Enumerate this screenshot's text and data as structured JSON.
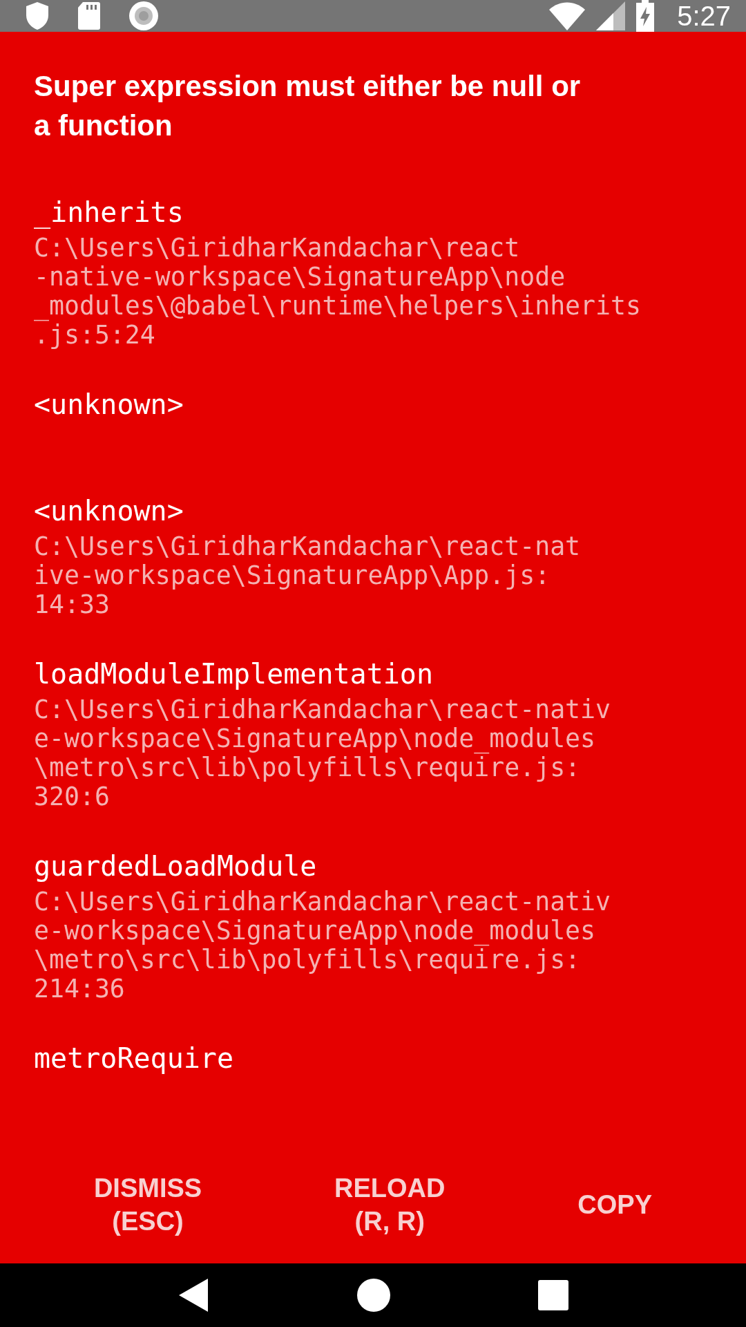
{
  "status_bar": {
    "time": "5:27"
  },
  "error": {
    "message": "Super expression must either be null or a function"
  },
  "stack": [
    {
      "method": "_inherits",
      "file_lines": [
        "C:\\Users\\GiridharKandachar\\react",
        "-native-workspace\\SignatureApp\\node",
        "_modules\\@babel\\runtime\\helpers\\inherits",
        ".js:5:24"
      ]
    },
    {
      "method": "<unknown>"
    },
    {
      "method": "<unknown>",
      "file_lines": [
        "C:\\Users\\GiridharKandachar\\react-nat",
        "ive-workspace\\SignatureApp\\App.js:",
        "14:33"
      ]
    },
    {
      "method": "loadModuleImplementation",
      "file_lines": [
        "C:\\Users\\GiridharKandachar\\react-nativ",
        "e-workspace\\SignatureApp\\node_modules",
        "\\metro\\src\\lib\\polyfills\\require.js:",
        "320:6"
      ]
    },
    {
      "method": "guardedLoadModule",
      "file_lines": [
        "C:\\Users\\GiridharKandachar\\react-nativ",
        "e-workspace\\SignatureApp\\node_modules",
        "\\metro\\src\\lib\\polyfills\\require.js:",
        "214:36"
      ]
    },
    {
      "method": "metroRequire"
    }
  ],
  "buttons": [
    {
      "label": "DISMISS",
      "hint": "(ESC)"
    },
    {
      "label": "RELOAD",
      "hint": "(R, R)"
    },
    {
      "label": "COPY"
    }
  ]
}
